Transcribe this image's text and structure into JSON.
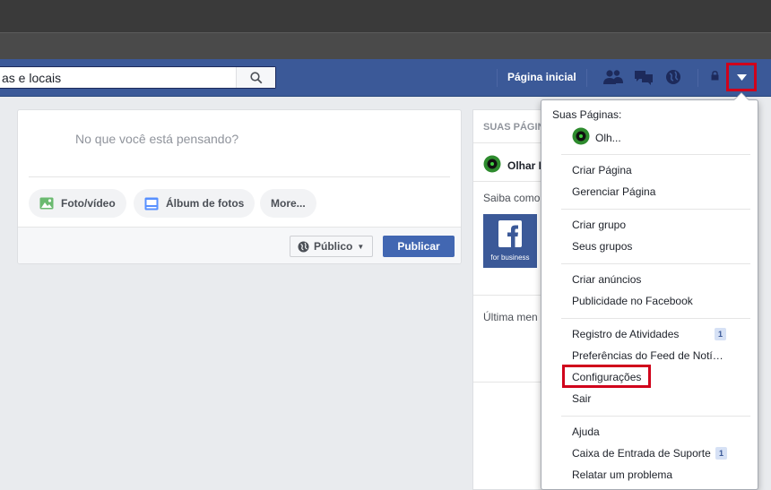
{
  "search": {
    "value": "as e locais"
  },
  "nav": {
    "home_label": "Página inicial"
  },
  "composer": {
    "prompt": "No que você está pensando?",
    "photo_video_label": "Foto/vídeo",
    "album_label": "Álbum de fotos",
    "more_label": "More...",
    "audience_label": "Público",
    "publish_label": "Publicar"
  },
  "right_column": {
    "pages_heading": "SUAS PÁGIN",
    "page_name": "Olhar D",
    "learn_text": "Saiba como",
    "fb_card_label": "for business",
    "last_text": "Última men"
  },
  "menu": {
    "pages_heading": "Suas Páginas:",
    "page_item": "Olh...",
    "items": [
      {
        "label": "Criar Página"
      },
      {
        "label": "Gerenciar Página"
      },
      {
        "label": "Criar grupo"
      },
      {
        "label": "Seus grupos"
      },
      {
        "label": "Criar anúncios"
      },
      {
        "label": "Publicidade no Facebook"
      },
      {
        "label": "Registro de Atividades",
        "badge": "1"
      },
      {
        "label": "Preferências do Feed de Notícias"
      },
      {
        "label": "Configurações"
      },
      {
        "label": "Sair"
      },
      {
        "label": "Ajuda"
      },
      {
        "label": "Caixa de Entrada de Suporte",
        "badge": "1"
      },
      {
        "label": "Relatar um problema"
      }
    ]
  },
  "colors": {
    "facebook_blue": "#3b5998",
    "highlight_red": "#d0021b",
    "publish_blue": "#4267b2"
  }
}
